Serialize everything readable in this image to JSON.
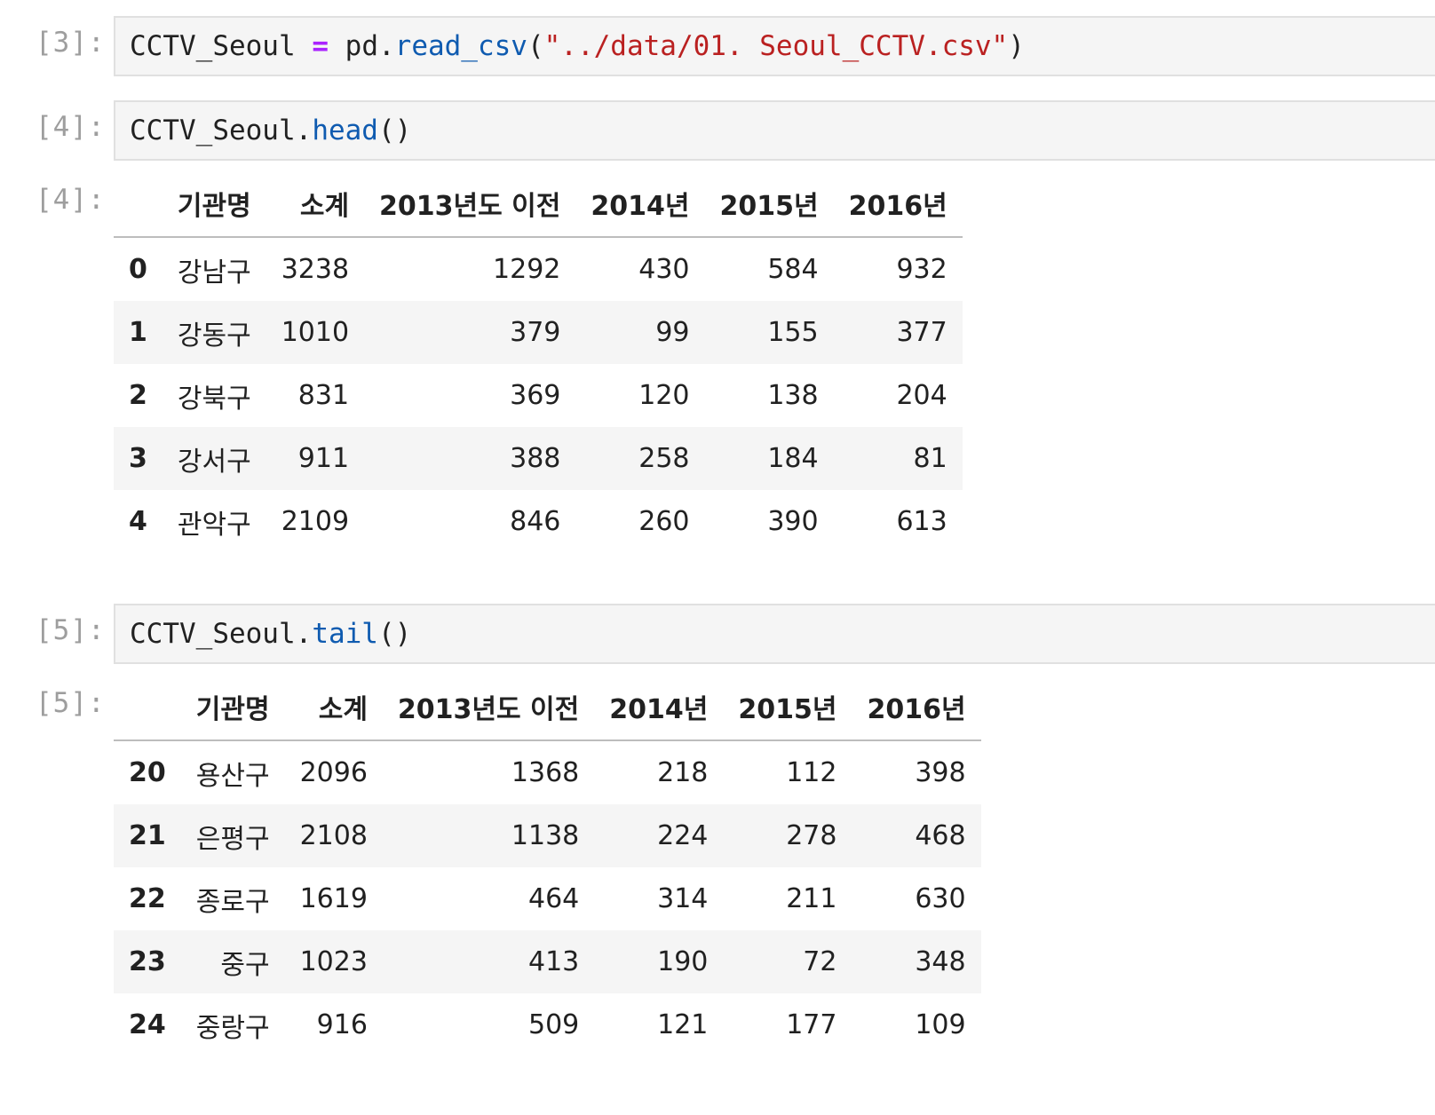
{
  "cells": {
    "c3": {
      "prompt": "[3]:",
      "code_var": "CCTV_Seoul",
      "code_op": "=",
      "code_obj": "pd.",
      "code_fn": "read_csv",
      "code_open": "(",
      "code_str": "\"../data/01. Seoul_CCTV.csv\"",
      "code_close": ")"
    },
    "c4": {
      "prompt": "[4]:",
      "code_obj": "CCTV_Seoul.",
      "code_fn": "head",
      "code_parens": "()",
      "out_prompt": "[4]:"
    },
    "c5": {
      "prompt": "[5]:",
      "code_obj": "CCTV_Seoul.",
      "code_fn": "tail",
      "code_parens": "()",
      "out_prompt": "[5]:"
    }
  },
  "columns": [
    "기관명",
    "소계",
    "2013년도 이전",
    "2014년",
    "2015년",
    "2016년"
  ],
  "head_rows": [
    {
      "index": "0",
      "values": [
        "강남구",
        "3238",
        "1292",
        "430",
        "584",
        "932"
      ]
    },
    {
      "index": "1",
      "values": [
        "강동구",
        "1010",
        "379",
        "99",
        "155",
        "377"
      ]
    },
    {
      "index": "2",
      "values": [
        "강북구",
        "831",
        "369",
        "120",
        "138",
        "204"
      ]
    },
    {
      "index": "3",
      "values": [
        "강서구",
        "911",
        "388",
        "258",
        "184",
        "81"
      ]
    },
    {
      "index": "4",
      "values": [
        "관악구",
        "2109",
        "846",
        "260",
        "390",
        "613"
      ]
    }
  ],
  "tail_rows": [
    {
      "index": "20",
      "values": [
        "용산구",
        "2096",
        "1368",
        "218",
        "112",
        "398"
      ]
    },
    {
      "index": "21",
      "values": [
        "은평구",
        "2108",
        "1138",
        "224",
        "278",
        "468"
      ]
    },
    {
      "index": "22",
      "values": [
        "종로구",
        "1619",
        "464",
        "314",
        "211",
        "630"
      ]
    },
    {
      "index": "23",
      "values": [
        "중구",
        "1023",
        "413",
        "190",
        "72",
        "348"
      ]
    },
    {
      "index": "24",
      "values": [
        "중랑구",
        "916",
        "509",
        "121",
        "177",
        "109"
      ]
    }
  ]
}
